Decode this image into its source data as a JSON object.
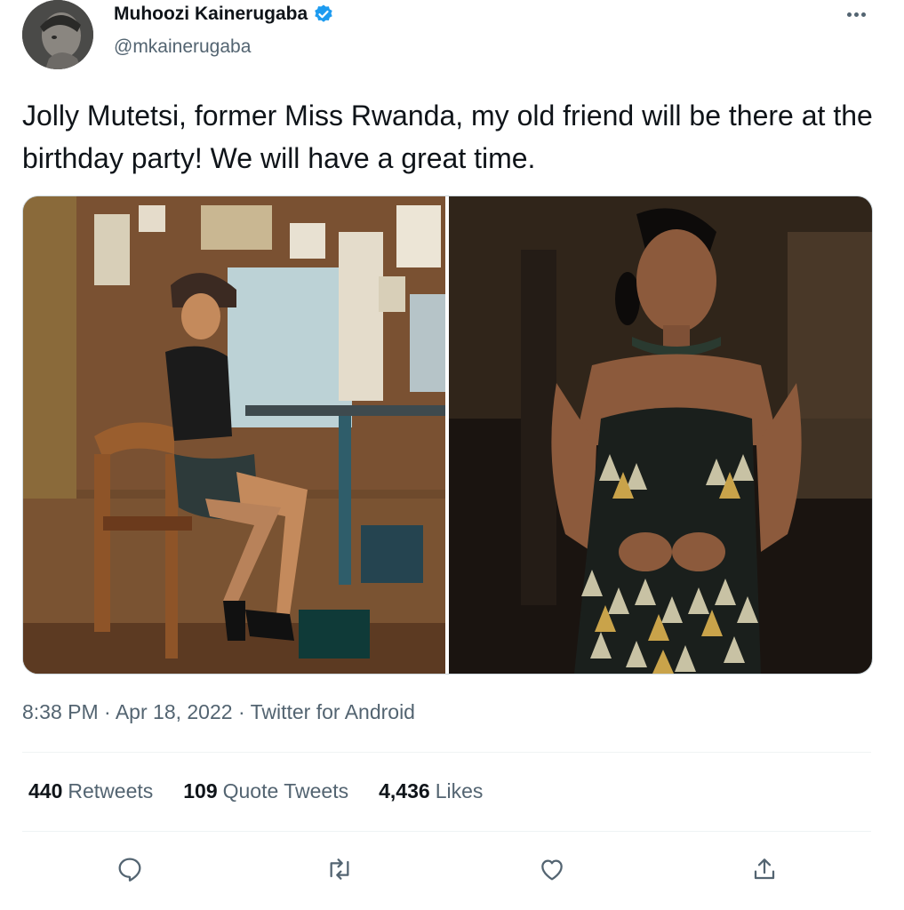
{
  "author": {
    "name": "Muhoozi Kainerugaba",
    "handle": "@mkainerugaba",
    "verified_icon": "verified-badge-icon",
    "badge_color": "#1d9bf0"
  },
  "more_icon": "more-horizontal-icon",
  "tweet": {
    "text": "Jolly Mutetsi, former Miss Rwanda, my old friend will be there at the birthday party! We will have a great time."
  },
  "meta": {
    "time": "8:38 PM",
    "sep1": "·",
    "date": "Apr 18, 2022",
    "sep2": "·",
    "source": "Twitter for Android"
  },
  "stats": {
    "retweets_count": "440",
    "retweets_label": "Retweets",
    "quotes_count": "109",
    "quotes_label": "Quote Tweets",
    "likes_count": "4,436",
    "likes_label": "Likes"
  },
  "actions": [
    "reply-icon",
    "retweet-icon",
    "like-icon",
    "share-icon"
  ],
  "colors": {
    "text": "#0f1419",
    "secondary": "#536471",
    "divider": "#eff3f4"
  }
}
